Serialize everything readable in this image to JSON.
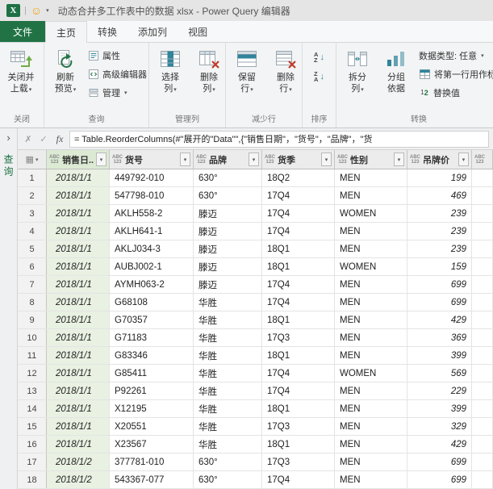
{
  "window": {
    "title": "动态合并多工作表中的数据 xlsx - Power Query 编辑器",
    "excel_badge": "X"
  },
  "glyphs": {
    "caret": "▾",
    "chevron_right": "›",
    "smiley": "☺",
    "separator": "|",
    "cancel": "✗",
    "check": "✓",
    "fx": "fx",
    "corner_grid": "▦",
    "sort_arrow": "↓"
  },
  "tabs": {
    "file": "文件",
    "home": "主页",
    "transform": "转换",
    "add_column": "添加列",
    "view": "视图"
  },
  "ribbon": {
    "close_group": {
      "label": "关闭",
      "close_load_line1": "关闭并",
      "close_load_line2": "上载"
    },
    "query_group": {
      "label": "查询",
      "refresh_line1": "刷新",
      "refresh_line2": "预览",
      "properties": "属性",
      "advanced_editor": "高级编辑器",
      "manage": "管理"
    },
    "manage_columns_group": {
      "label": "管理列",
      "choose_line1": "选择",
      "choose_line2": "列",
      "remove_line1": "删除",
      "remove_line2": "列"
    },
    "reduce_rows_group": {
      "label": "减少行",
      "keep_line1": "保留",
      "keep_line2": "行",
      "remove_line1": "删除",
      "remove_line2": "行"
    },
    "sort_group": {
      "label": "排序",
      "asc_top": "A",
      "asc_bottom": "Z",
      "desc_top": "Z",
      "desc_bottom": "A"
    },
    "transform_group": {
      "label": "转换",
      "split_line1": "拆分",
      "split_line2": "列",
      "group_line1": "分组",
      "group_line2": "依据",
      "data_type": "数据类型: 任意",
      "first_row": "将第一行用作标",
      "replace_values": "替换值",
      "replace_digit1": "1",
      "replace_digit2": "2"
    }
  },
  "query_pane": {
    "collapsed_label": "查询"
  },
  "formula_bar": {
    "formula": "= Table.ReorderColumns(#\"展开的\"Data\"\",{\"销售日期\"，\"货号\"，\"品牌\"，\"货"
  },
  "table": {
    "type_icon_top": "ABC",
    "type_icon_bottom": "123",
    "columns": [
      "销售日...",
      "货号",
      "品牌",
      "货季",
      "性别",
      "吊牌价",
      ""
    ],
    "rows": [
      [
        "1",
        "2018/1/1",
        "449792-010",
        "630°",
        "18Q2",
        "MEN",
        "199"
      ],
      [
        "2",
        "2018/1/1",
        "547798-010",
        "630°",
        "17Q4",
        "MEN",
        "469"
      ],
      [
        "3",
        "2018/1/1",
        "AKLH558-2",
        "滕迈",
        "17Q4",
        "WOMEN",
        "239"
      ],
      [
        "4",
        "2018/1/1",
        "AKLH641-1",
        "滕迈",
        "17Q4",
        "MEN",
        "239"
      ],
      [
        "5",
        "2018/1/1",
        "AKLJ034-3",
        "滕迈",
        "18Q1",
        "MEN",
        "239"
      ],
      [
        "6",
        "2018/1/1",
        "AUBJ002-1",
        "滕迈",
        "18Q1",
        "WOMEN",
        "159"
      ],
      [
        "7",
        "2018/1/1",
        "AYMH063-2",
        "滕迈",
        "17Q4",
        "MEN",
        "699"
      ],
      [
        "8",
        "2018/1/1",
        "G68108",
        "华胜",
        "17Q4",
        "MEN",
        "699"
      ],
      [
        "9",
        "2018/1/1",
        "G70357",
        "华胜",
        "18Q1",
        "MEN",
        "429"
      ],
      [
        "10",
        "2018/1/1",
        "G71183",
        "华胜",
        "17Q3",
        "MEN",
        "369"
      ],
      [
        "11",
        "2018/1/1",
        "G83346",
        "华胜",
        "18Q1",
        "MEN",
        "399"
      ],
      [
        "12",
        "2018/1/1",
        "G85411",
        "华胜",
        "17Q4",
        "WOMEN",
        "569"
      ],
      [
        "13",
        "2018/1/1",
        "P92261",
        "华胜",
        "17Q4",
        "MEN",
        "229"
      ],
      [
        "14",
        "2018/1/1",
        "X12195",
        "华胜",
        "18Q1",
        "MEN",
        "399"
      ],
      [
        "15",
        "2018/1/1",
        "X20551",
        "华胜",
        "17Q3",
        "MEN",
        "329"
      ],
      [
        "16",
        "2018/1/1",
        "X23567",
        "华胜",
        "18Q1",
        "MEN",
        "429"
      ],
      [
        "17",
        "2018/1/2",
        "377781-010",
        "630°",
        "17Q3",
        "MEN",
        "699"
      ],
      [
        "18",
        "2018/1/2",
        "543367-077",
        "630°",
        "17Q4",
        "MEN",
        "699"
      ]
    ]
  }
}
